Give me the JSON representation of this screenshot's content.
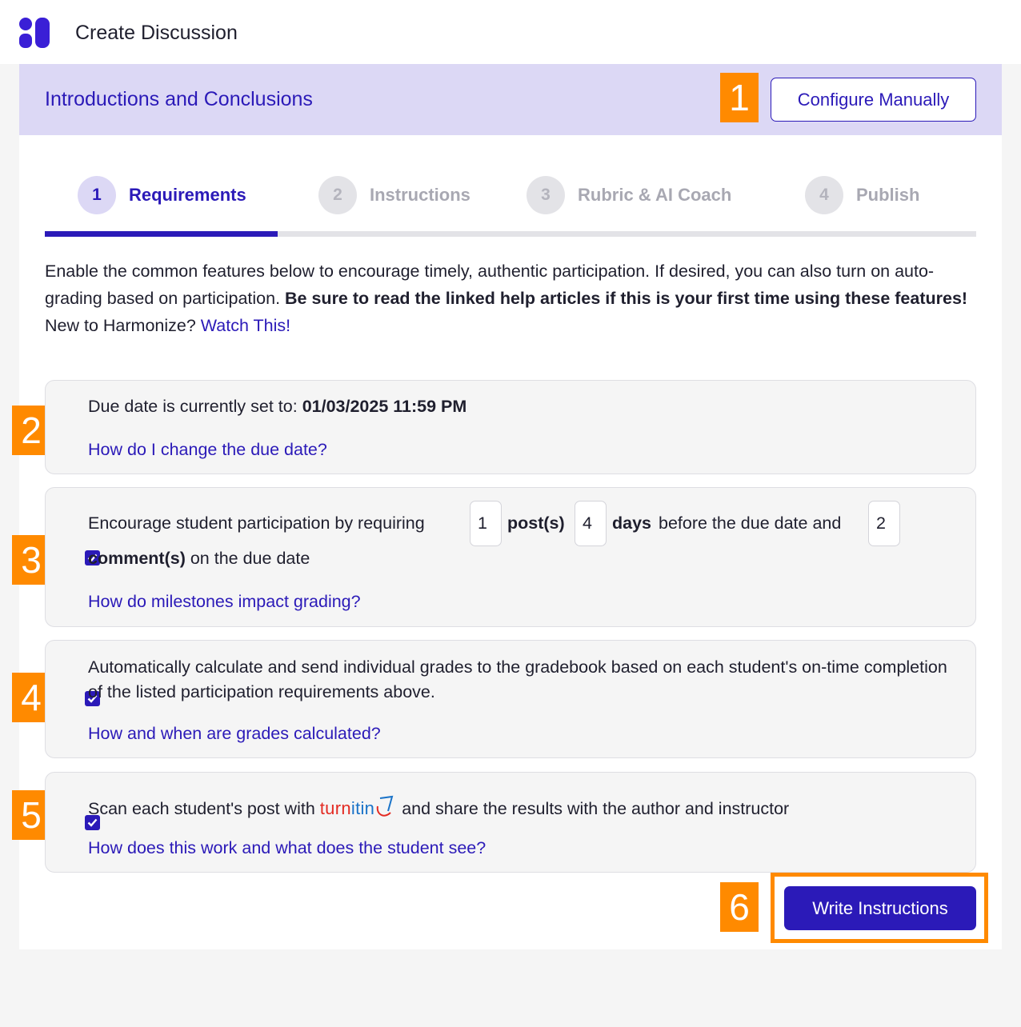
{
  "app": {
    "title": "Create Discussion"
  },
  "banner": {
    "title": "Introductions and Conclusions",
    "configure_label": "Configure Manually"
  },
  "steps": [
    {
      "number": "1",
      "label": "Requirements",
      "active": true
    },
    {
      "number": "2",
      "label": "Instructions",
      "active": false
    },
    {
      "number": "3",
      "label": "Rubric & AI Coach",
      "active": false
    },
    {
      "number": "4",
      "label": "Publish",
      "active": false
    }
  ],
  "intro": {
    "text": "Enable the common features below to encourage timely, authentic participation. If desired, you can also turn on auto-grading based on participation. ",
    "bold": "Be sure to read the linked help articles if this is your first time using these features!",
    "new_prefix": "New to Harmonize? ",
    "watch_link": "Watch This!"
  },
  "due_date": {
    "prefix": "Due date is currently set to: ",
    "value": "01/03/2025 11:59 PM",
    "help_link": "How do I change the due date?"
  },
  "milestones": {
    "checked": true,
    "text1": "Encourage student participation by requiring",
    "posts_value": "1",
    "posts_label": "post(s)",
    "days_value": "4",
    "days_label": "days",
    "text2": "before the due date and",
    "comments_value": "2",
    "comments_label": "comment(s)",
    "text3": "on the due date",
    "help_link": "How do milestones impact grading?"
  },
  "autograde": {
    "checked": true,
    "text": "Automatically calculate and send individual grades to the gradebook based on each student's on-time completion of the listed participation requirements above.",
    "help_link": "How and when are grades calculated?"
  },
  "turnitin": {
    "checked": true,
    "prefix": "Scan each student's post with",
    "brand_red": "turn",
    "brand_blue": "itin",
    "suffix": "and share the results with the author and instructor",
    "help_link": "How does this work and what does the student see?"
  },
  "footer": {
    "write_label": "Write Instructions"
  },
  "annotations": [
    "1",
    "2",
    "3",
    "4",
    "5",
    "6"
  ],
  "colors": {
    "accent": "#2b1ab8",
    "banner_bg": "#dcd8f5",
    "annotation": "#ff8a00",
    "turnitin_red": "#e32b23",
    "turnitin_blue": "#1a73c8"
  }
}
